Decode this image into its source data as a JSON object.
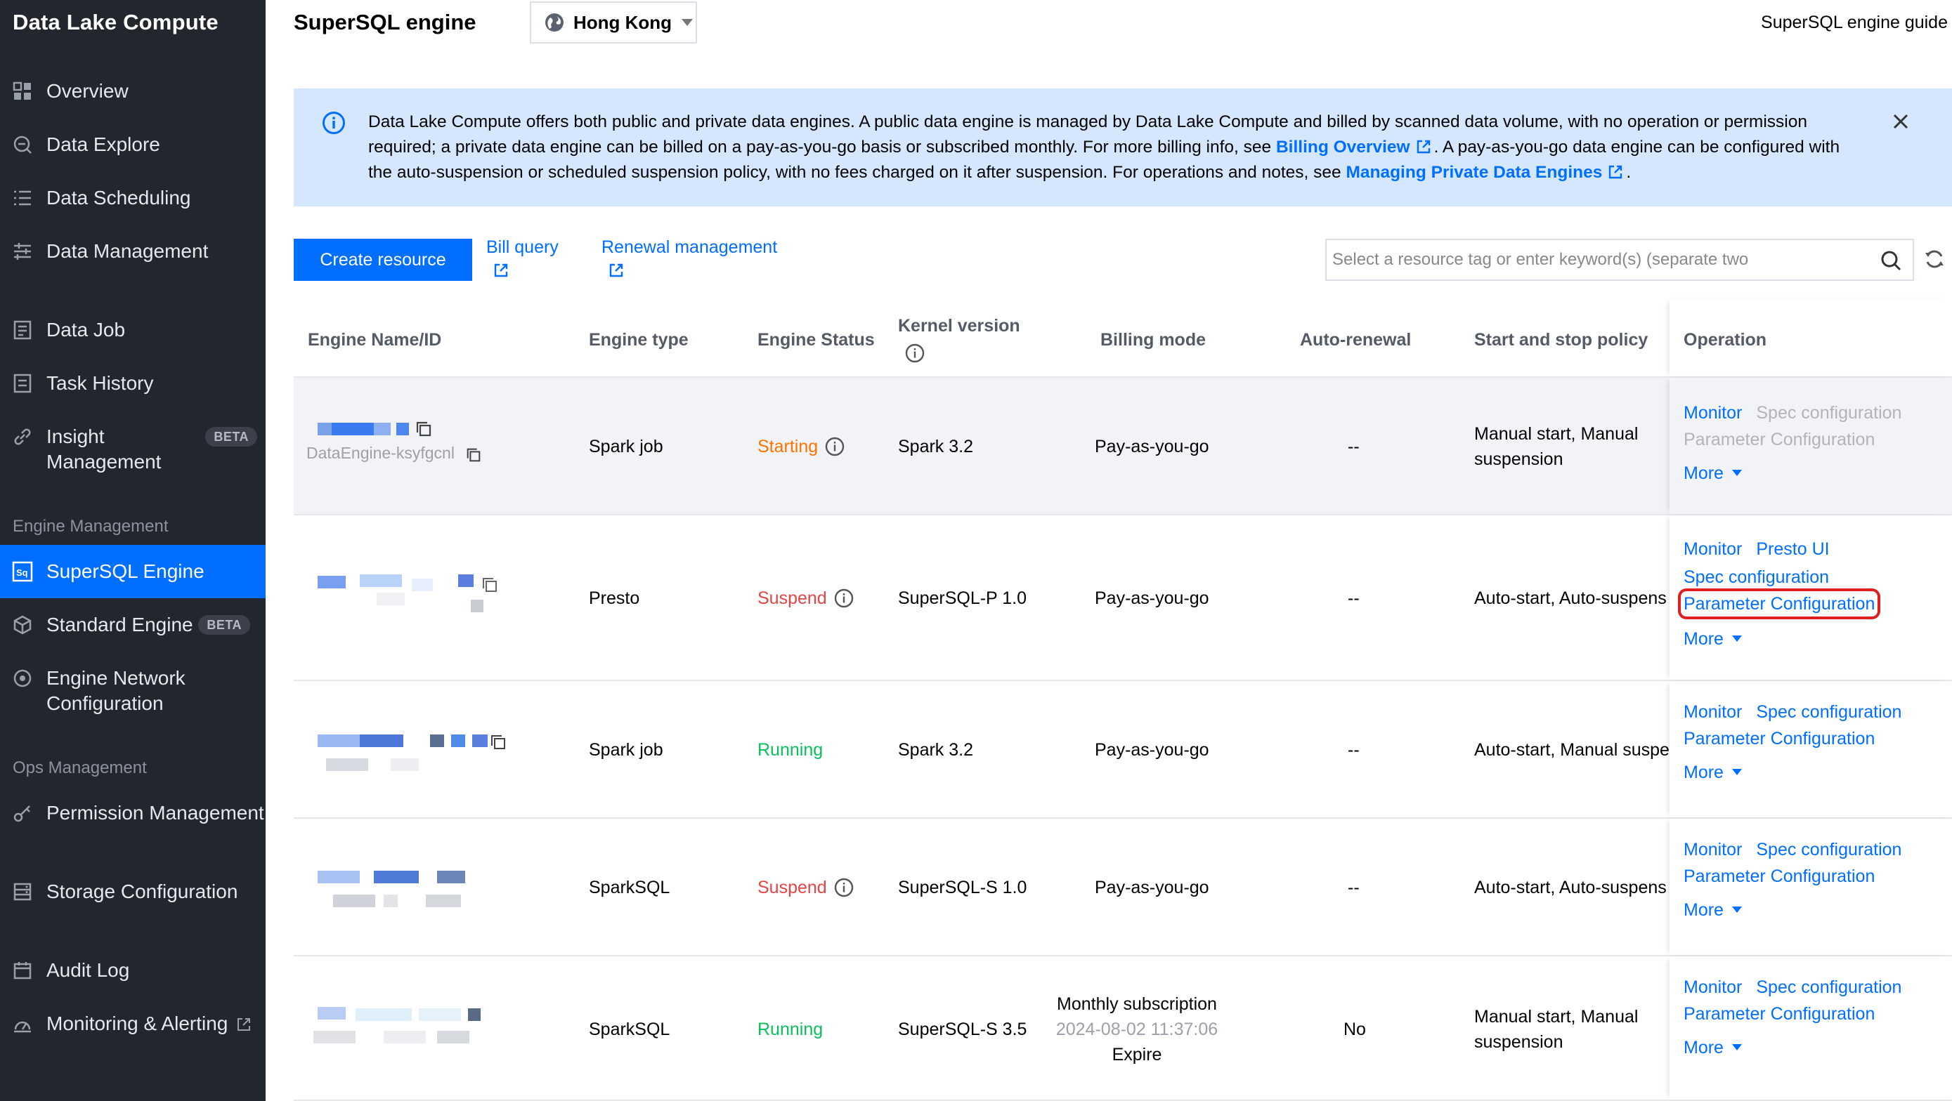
{
  "sidebar": {
    "brand": "Data Lake Compute",
    "items": [
      {
        "label": "Overview"
      },
      {
        "label": "Data Explore"
      },
      {
        "label": "Data Scheduling"
      },
      {
        "label": "Data Management"
      },
      {
        "label": "Data Job"
      },
      {
        "label": "Task History"
      },
      {
        "label": "Insight Management",
        "badge": "BETA"
      },
      {
        "label": "SuperSQL Engine"
      },
      {
        "label": "Standard Engine",
        "badge": "BETA"
      },
      {
        "label": "Engine Network Configuration"
      },
      {
        "label": "Permission Management"
      },
      {
        "label": "Storage Configuration"
      },
      {
        "label": "Audit Log"
      },
      {
        "label": "Monitoring & Alerting"
      }
    ],
    "sections": {
      "engine": "Engine Management",
      "ops": "Ops Management"
    }
  },
  "header": {
    "title": "SuperSQL engine",
    "region": "Hong Kong",
    "guide": "SuperSQL engine guide"
  },
  "banner": {
    "part1": "Data Lake Compute offers both public and private data engines. A public data engine is managed by Data Lake Compute and billed by scanned data volume, with no operation or permission required; a private data engine can be billed on a pay-as-you-go basis or subscribed monthly. For more billing info, see ",
    "link1": "Billing Overview",
    "part2": ". A pay-as-you-go data engine can be configured with the auto-suspension or scheduled suspension policy, with no fees charged on it after suspension. For operations and notes, see ",
    "link2": "Managing Private Data Engines",
    "part3": "."
  },
  "toolbar": {
    "create": "Create resource",
    "bill": "Bill query",
    "renewal": "Renewal management",
    "search_placeholder": "Select a resource tag or enter keyword(s) (separate two"
  },
  "table": {
    "headers": {
      "name": "Engine Name/ID",
      "type": "Engine type",
      "status": "Engine Status",
      "kernel": "Kernel version",
      "billing": "Billing mode",
      "renewal": "Auto-renewal",
      "policy": "Start and stop policy",
      "operation": "Operation"
    },
    "rows": [
      {
        "id_text": "DataEngine-ksyfgcnl",
        "type": "Spark job",
        "status": "Starting",
        "kernel": "Spark 3.2",
        "billing": "Pay-as-you-go",
        "renewal": "--",
        "policy_a": "Manual start,  Manual",
        "policy_b": "suspension"
      },
      {
        "type": "Presto",
        "status": "Suspend",
        "kernel": "SuperSQL-P 1.0",
        "billing": "Pay-as-you-go",
        "renewal": "--",
        "policy_a": "Auto-start,  Auto-suspens"
      },
      {
        "type": "Spark job",
        "status": "Running",
        "kernel": "Spark 3.2",
        "billing": "Pay-as-you-go",
        "renewal": "--",
        "policy_a": "Auto-start,  Manual suspe"
      },
      {
        "type": "SparkSQL",
        "status": "Suspend",
        "kernel": "SuperSQL-S 1.0",
        "billing": "Pay-as-you-go",
        "renewal": "--",
        "policy_a": "Auto-start,  Auto-suspens"
      },
      {
        "type": "SparkSQL",
        "status": "Running",
        "kernel": "SuperSQL-S 3.5",
        "billing_a": "Monthly subscription",
        "billing_b": "2024-08-02 11:37:06",
        "billing_c": "Expire",
        "renewal": "No",
        "policy_a": "Manual start,  Manual",
        "policy_b": "suspension"
      }
    ],
    "ops": {
      "monitor": "Monitor",
      "spec": "Spec configuration",
      "param": "Parameter Configuration",
      "presto": "Presto UI",
      "more": "More"
    }
  }
}
